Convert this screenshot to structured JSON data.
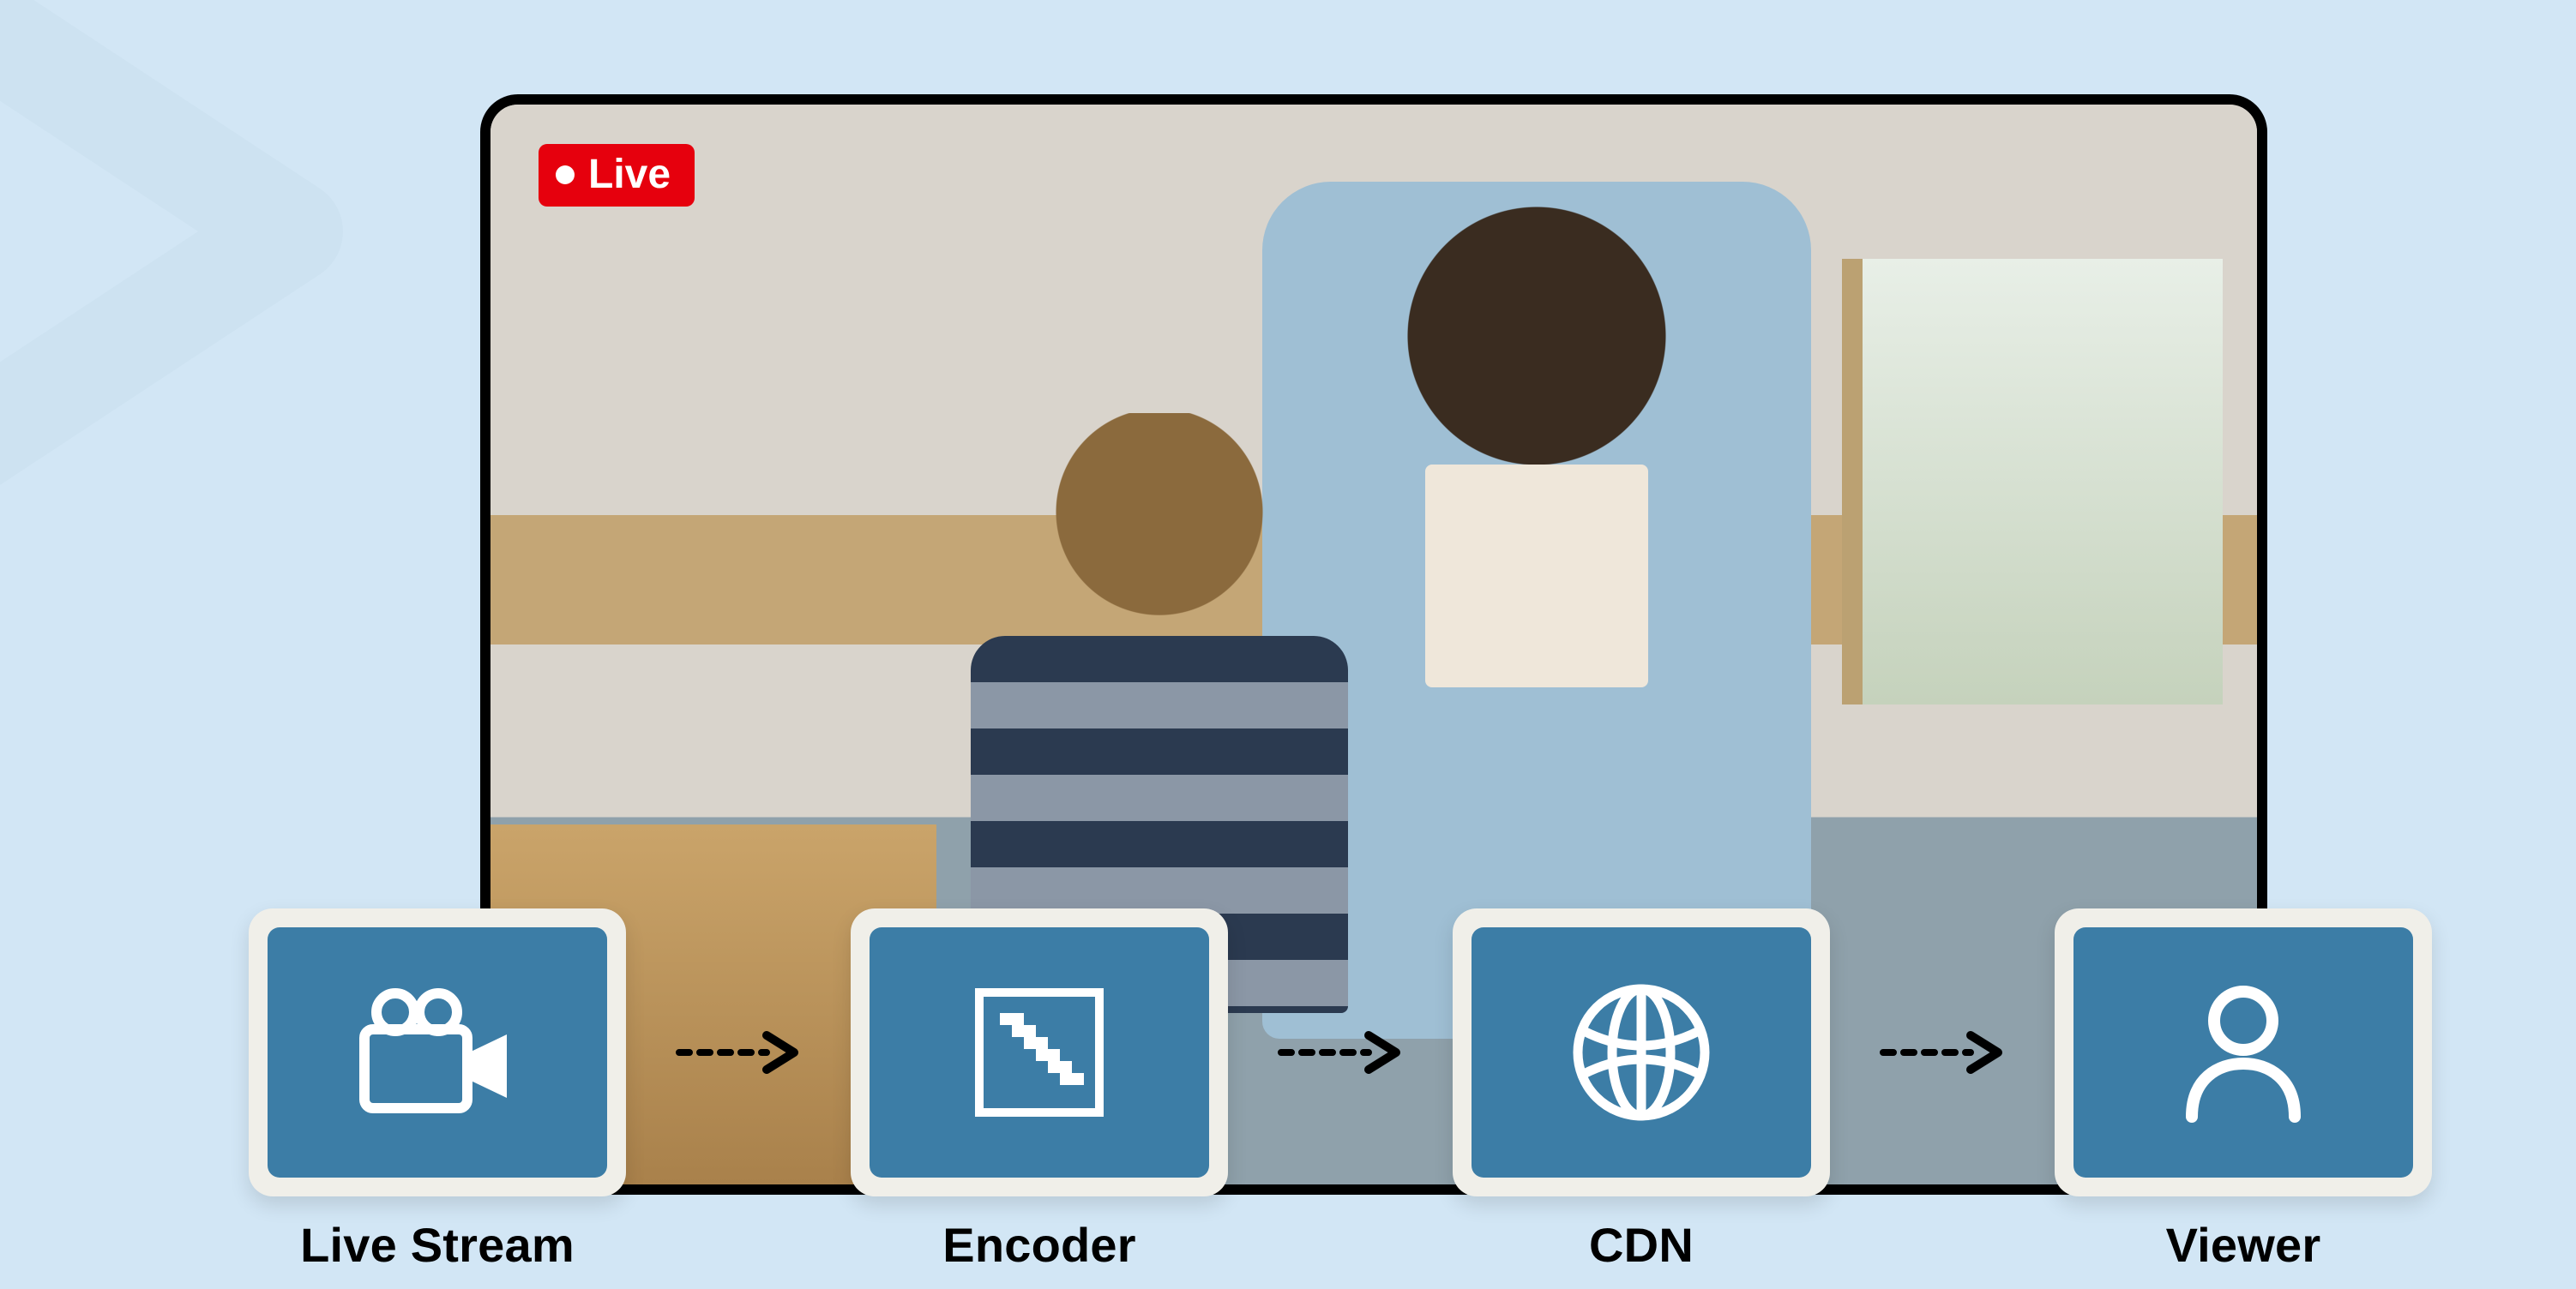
{
  "live_badge": {
    "text": "Live"
  },
  "flow": {
    "steps": [
      {
        "icon": "camera-icon",
        "label": "Live Stream"
      },
      {
        "icon": "encoder-icon",
        "label": "Encoder"
      },
      {
        "icon": "globe-icon",
        "label": "CDN"
      },
      {
        "icon": "user-icon",
        "label": "Viewer"
      }
    ]
  },
  "colors": {
    "page_bg": "#d2e6f5",
    "card_bg": "#f0efe9",
    "tile_bg": "#3c7da6",
    "live_bg": "#e6000d"
  }
}
